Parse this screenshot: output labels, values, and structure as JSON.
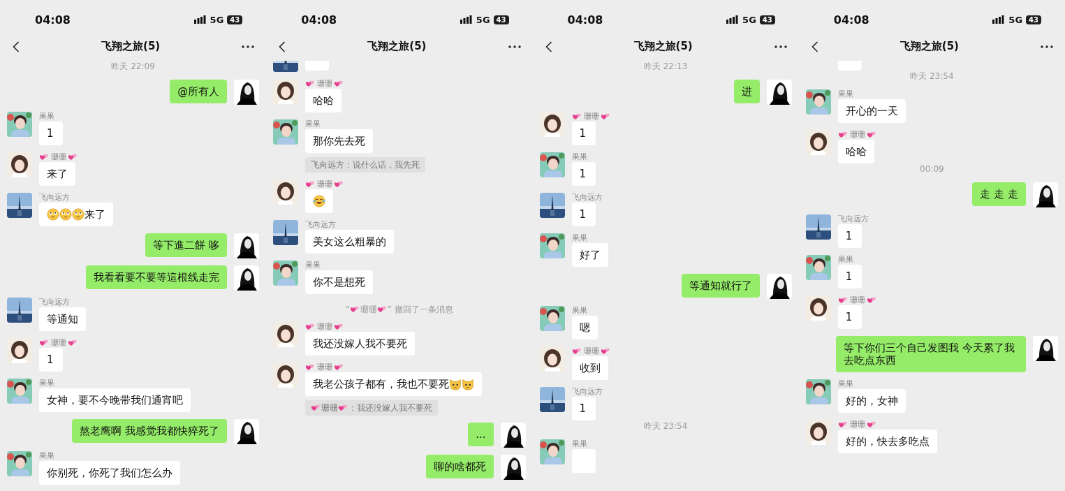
{
  "screens": [
    {
      "status": {
        "time": "04:08",
        "network": "5G",
        "battery": "43"
      },
      "header": {
        "title": "飞翔之旅(5)"
      },
      "messages": [
        {
          "kind": "time",
          "text": "昨天 22:09"
        },
        {
          "kind": "out",
          "avatar": {
            "kind": "dark"
          },
          "text": "@所有人"
        },
        {
          "kind": "in",
          "avatar": {
            "kind": "teal"
          },
          "sender": "果果",
          "text": "1"
        },
        {
          "kind": "in",
          "avatar": {
            "kind": "cream"
          },
          "sender": [
            {
              "kind": "hearts"
            },
            {
              "kind": "text",
              "text": "珊珊"
            },
            {
              "kind": "hearts"
            }
          ],
          "text": "来了"
        },
        {
          "kind": "in",
          "avatar": {
            "kind": "city"
          },
          "sender": "飞向远方",
          "text": [
            {
              "kind": "eyeroll"
            },
            {
              "kind": "eyeroll"
            },
            {
              "kind": "eyeroll"
            },
            {
              "kind": "text",
              "text": "来了"
            }
          ]
        },
        {
          "kind": "out",
          "avatar": {
            "kind": "dark"
          },
          "text": "等下進二餅 哆"
        },
        {
          "kind": "out",
          "avatar": {
            "kind": "dark"
          },
          "text": "我看看要不要等這根线走完"
        },
        {
          "kind": "in",
          "avatar": {
            "kind": "city"
          },
          "sender": "飞向远方",
          "text": "等通知"
        },
        {
          "kind": "in",
          "avatar": {
            "kind": "cream"
          },
          "sender": [
            {
              "kind": "hearts"
            },
            {
              "kind": "text",
              "text": "珊珊"
            },
            {
              "kind": "hearts"
            }
          ],
          "text": "1"
        },
        {
          "kind": "in",
          "avatar": {
            "kind": "teal"
          },
          "sender": "果果",
          "text": "女神，要不今晚带我们通宵吧"
        },
        {
          "kind": "out",
          "avatar": {
            "kind": "dark"
          },
          "text": "熬老鹰啊 我感觉我都快猝死了"
        },
        {
          "kind": "in",
          "avatar": {
            "kind": "teal"
          },
          "sender": "果果",
          "text": "你别死，你死了我们怎么办"
        }
      ]
    },
    {
      "status": {
        "time": "04:08",
        "network": "5G",
        "battery": "43"
      },
      "header": {
        "title": "飞翔之旅(5)"
      },
      "messages": [
        {
          "kind": "peek",
          "avatar": {
            "kind": "city"
          }
        },
        {
          "kind": "in",
          "avatar": {
            "kind": "cream"
          },
          "sender": [
            {
              "kind": "hearts"
            },
            {
              "kind": "text",
              "text": "珊珊"
            },
            {
              "kind": "hearts"
            }
          ],
          "text": "哈哈"
        },
        {
          "kind": "in",
          "avatar": {
            "kind": "teal"
          },
          "sender": "果果",
          "text": "那你先去死"
        },
        {
          "kind": "quote",
          "text": "飞向远方：说什么话，我先死"
        },
        {
          "kind": "in",
          "avatar": {
            "kind": "cream"
          },
          "sender": [
            {
              "kind": "hearts"
            },
            {
              "kind": "text",
              "text": "珊珊"
            },
            {
              "kind": "hearts"
            }
          ],
          "text": [
            {
              "kind": "laugh"
            }
          ]
        },
        {
          "kind": "in",
          "avatar": {
            "kind": "city"
          },
          "sender": "飞向远方",
          "text": "美女这么粗暴的"
        },
        {
          "kind": "in",
          "avatar": {
            "kind": "teal"
          },
          "sender": "果果",
          "text": "你不是想死"
        },
        {
          "kind": "recall",
          "text": [
            {
              "kind": "text",
              "text": "“"
            },
            {
              "kind": "hearts"
            },
            {
              "kind": "text",
              "text": "珊珊"
            },
            {
              "kind": "hearts"
            },
            {
              "kind": "text",
              "text": "” 撤回了一条消息"
            }
          ]
        },
        {
          "kind": "in",
          "avatar": {
            "kind": "cream"
          },
          "sender": [
            {
              "kind": "hearts"
            },
            {
              "kind": "text",
              "text": "珊珊"
            },
            {
              "kind": "hearts"
            }
          ],
          "text": "我还没嫁人我不要死"
        },
        {
          "kind": "in",
          "avatar": {
            "kind": "cream"
          },
          "sender": [
            {
              "kind": "hearts"
            },
            {
              "kind": "text",
              "text": "珊珊"
            },
            {
              "kind": "hearts"
            }
          ],
          "text": [
            {
              "kind": "text",
              "text": "我老公孩子都有，我也不要死"
            },
            {
              "kind": "cat"
            },
            {
              "kind": "cat"
            }
          ]
        },
        {
          "kind": "quote",
          "text": [
            {
              "kind": "hearts"
            },
            {
              "kind": "text",
              "text": "珊珊"
            },
            {
              "kind": "hearts"
            },
            {
              "kind": "text",
              "text": "：我还没嫁人我不要死"
            }
          ]
        },
        {
          "kind": "out",
          "avatar": {
            "kind": "dark"
          },
          "text": "..."
        },
        {
          "kind": "out",
          "avatar": {
            "kind": "dark"
          },
          "text": "聊的啥都死"
        }
      ]
    },
    {
      "status": {
        "time": "04:08",
        "network": "5G",
        "battery": "43"
      },
      "header": {
        "title": "飞翔之旅(5)"
      },
      "messages": [
        {
          "kind": "time",
          "text": "昨天 22:13"
        },
        {
          "kind": "out",
          "avatar": {
            "kind": "dark"
          },
          "text": "进"
        },
        {
          "kind": "in",
          "avatar": {
            "kind": "cream"
          },
          "sender": [
            {
              "kind": "hearts"
            },
            {
              "kind": "text",
              "text": "珊珊"
            },
            {
              "kind": "hearts"
            }
          ],
          "text": "1"
        },
        {
          "kind": "in",
          "avatar": {
            "kind": "teal"
          },
          "sender": "果果",
          "text": "1"
        },
        {
          "kind": "in",
          "avatar": {
            "kind": "city"
          },
          "sender": "飞向远方",
          "text": "1"
        },
        {
          "kind": "in",
          "avatar": {
            "kind": "teal"
          },
          "sender": "果果",
          "text": "好了"
        },
        {
          "kind": "out",
          "avatar": {
            "kind": "dark"
          },
          "text": "等通知就行了"
        },
        {
          "kind": "in",
          "avatar": {
            "kind": "teal"
          },
          "sender": "果果",
          "text": "嗯"
        },
        {
          "kind": "in",
          "avatar": {
            "kind": "cream"
          },
          "sender": [
            {
              "kind": "hearts"
            },
            {
              "kind": "text",
              "text": "珊珊"
            },
            {
              "kind": "hearts"
            }
          ],
          "text": "收到"
        },
        {
          "kind": "in",
          "avatar": {
            "kind": "city"
          },
          "sender": "飞向远方",
          "text": "1"
        },
        {
          "kind": "time",
          "text": "昨天 23:54"
        },
        {
          "kind": "in",
          "avatar": {
            "kind": "teal"
          },
          "sender": "果果"
        }
      ]
    },
    {
      "status": {
        "time": "04:08",
        "network": "5G",
        "battery": "43"
      },
      "header": {
        "title": "飞翔之旅(5)"
      },
      "messages": [
        {
          "kind": "peek"
        },
        {
          "kind": "time",
          "text": "昨天 23:54"
        },
        {
          "kind": "in",
          "avatar": {
            "kind": "teal"
          },
          "sender": "果果",
          "text": "开心的一天"
        },
        {
          "kind": "in",
          "avatar": {
            "kind": "cream"
          },
          "sender": [
            {
              "kind": "hearts"
            },
            {
              "kind": "text",
              "text": "珊珊"
            },
            {
              "kind": "hearts"
            }
          ],
          "text": "哈哈"
        },
        {
          "kind": "time",
          "text": "00:09"
        },
        {
          "kind": "out",
          "avatar": {
            "kind": "dark"
          },
          "text": "走 走 走"
        },
        {
          "kind": "in",
          "avatar": {
            "kind": "city"
          },
          "sender": "飞向远方",
          "text": "1"
        },
        {
          "kind": "in",
          "avatar": {
            "kind": "teal"
          },
          "sender": "果果",
          "text": "1"
        },
        {
          "kind": "in",
          "avatar": {
            "kind": "cream"
          },
          "sender": [
            {
              "kind": "hearts"
            },
            {
              "kind": "text",
              "text": "珊珊"
            },
            {
              "kind": "hearts"
            }
          ],
          "text": "1"
        },
        {
          "kind": "out",
          "avatar": {
            "kind": "dark"
          },
          "text": "等下你们三个自己发图我 今天累了我去吃点东西"
        },
        {
          "kind": "in",
          "avatar": {
            "kind": "teal"
          },
          "sender": "果果",
          "text": "好的，女神"
        },
        {
          "kind": "in",
          "avatar": {
            "kind": "cream"
          },
          "sender": [
            {
              "kind": "hearts"
            },
            {
              "kind": "text",
              "text": "珊珊"
            },
            {
              "kind": "hearts"
            }
          ],
          "text": "好的，快去多吃点"
        }
      ]
    }
  ]
}
